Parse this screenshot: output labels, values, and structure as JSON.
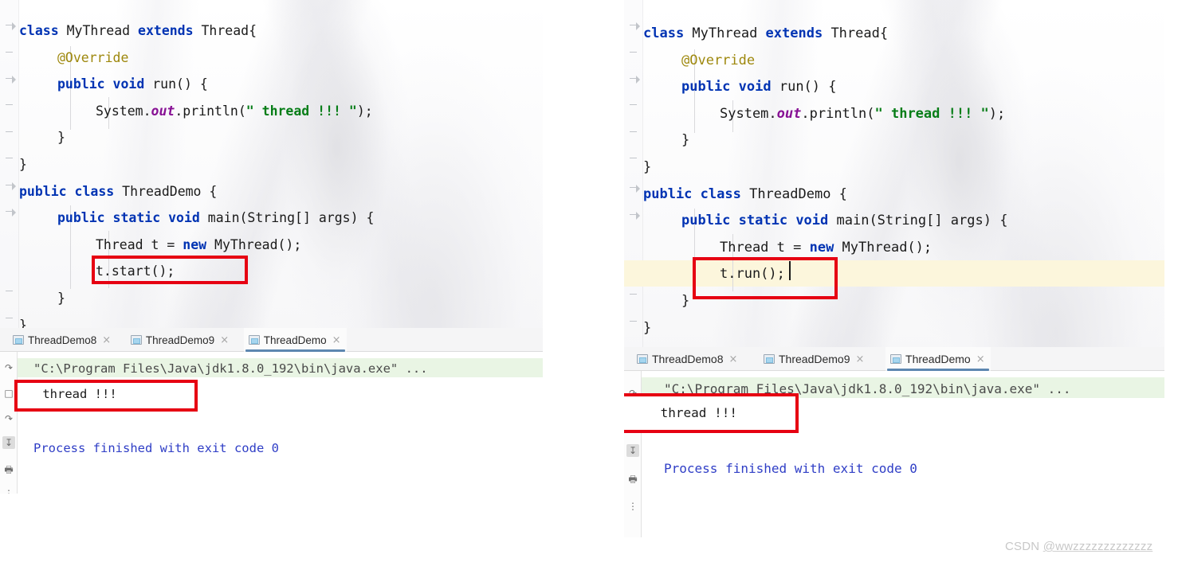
{
  "watermark": {
    "brand": "CSDN",
    "user": "@wwzzzzzzzzzzzzz"
  },
  "left_panel": {
    "name": "start-example-panel",
    "editor": {
      "lines": [
        {
          "indent": 0,
          "tokens": [
            {
              "t": "class ",
              "c": "kw"
            },
            {
              "t": "MyThread ",
              "c": "pln"
            },
            {
              "t": "extends ",
              "c": "kw"
            },
            {
              "t": "Thread{",
              "c": "pln"
            }
          ]
        },
        {
          "indent": 1,
          "tokens": [
            {
              "t": "@Override",
              "c": "ann"
            }
          ]
        },
        {
          "indent": 1,
          "tokens": [
            {
              "t": "public ",
              "c": "kw"
            },
            {
              "t": "void ",
              "c": "kw"
            },
            {
              "t": "run() {",
              "c": "pln"
            }
          ]
        },
        {
          "indent": 2,
          "tokens": [
            {
              "t": "System.",
              "c": "pln"
            },
            {
              "t": "out",
              "c": "fld"
            },
            {
              "t": ".println(",
              "c": "pln"
            },
            {
              "t": "\" thread !!! \"",
              "c": "str"
            },
            {
              "t": ");",
              "c": "pln"
            }
          ]
        },
        {
          "indent": 1,
          "tokens": [
            {
              "t": "}",
              "c": "pln"
            }
          ]
        },
        {
          "indent": 0,
          "tokens": [
            {
              "t": "}",
              "c": "pln"
            }
          ]
        },
        {
          "indent": 0,
          "tokens": [
            {
              "t": "public ",
              "c": "kw"
            },
            {
              "t": "class ",
              "c": "kw"
            },
            {
              "t": "ThreadDemo {",
              "c": "pln"
            }
          ]
        },
        {
          "indent": 1,
          "tokens": [
            {
              "t": "public ",
              "c": "kw"
            },
            {
              "t": "static ",
              "c": "kw"
            },
            {
              "t": "void ",
              "c": "kw"
            },
            {
              "t": "main(String[] args) {",
              "c": "pln"
            }
          ]
        },
        {
          "indent": 2,
          "tokens": [
            {
              "t": "Thread t = ",
              "c": "pln"
            },
            {
              "t": "new ",
              "c": "kw"
            },
            {
              "t": "MyThread();",
              "c": "pln"
            }
          ]
        },
        {
          "indent": 2,
          "tokens": [
            {
              "t": "t.start();",
              "c": "pln"
            }
          ]
        },
        {
          "indent": 1,
          "tokens": [
            {
              "t": "}",
              "c": "pln"
            }
          ]
        },
        {
          "indent": 0,
          "tokens": [
            {
              "t": "}",
              "c": "pln"
            }
          ]
        }
      ],
      "highlight_label": "t.start();"
    },
    "run_window": {
      "tabs": [
        {
          "label": "ThreadDemo8",
          "active": false,
          "close": "×"
        },
        {
          "label": "ThreadDemo9",
          "active": false,
          "close": "×"
        },
        {
          "label": "ThreadDemo",
          "active": true,
          "close": "×"
        }
      ],
      "console": {
        "command": "\"C:\\Program Files\\Java\\jdk1.8.0_192\\bin\\java.exe\" ...",
        "output": " thread !!!",
        "exit": "Process finished with exit code 0"
      }
    }
  },
  "right_panel": {
    "name": "run-example-panel",
    "editor": {
      "lines": [
        {
          "indent": 0,
          "tokens": [
            {
              "t": "class ",
              "c": "kw"
            },
            {
              "t": "MyThread ",
              "c": "pln"
            },
            {
              "t": "extends ",
              "c": "kw"
            },
            {
              "t": "Thread{",
              "c": "pln"
            }
          ]
        },
        {
          "indent": 1,
          "tokens": [
            {
              "t": "@Override",
              "c": "ann"
            }
          ]
        },
        {
          "indent": 1,
          "tokens": [
            {
              "t": "public ",
              "c": "kw"
            },
            {
              "t": "void ",
              "c": "kw"
            },
            {
              "t": "run() {",
              "c": "pln"
            }
          ]
        },
        {
          "indent": 2,
          "tokens": [
            {
              "t": "System.",
              "c": "pln"
            },
            {
              "t": "out",
              "c": "fld"
            },
            {
              "t": ".println(",
              "c": "pln"
            },
            {
              "t": "\" thread !!! \"",
              "c": "str"
            },
            {
              "t": ");",
              "c": "pln"
            }
          ]
        },
        {
          "indent": 1,
          "tokens": [
            {
              "t": "}",
              "c": "pln"
            }
          ]
        },
        {
          "indent": 0,
          "tokens": [
            {
              "t": "}",
              "c": "pln"
            }
          ]
        },
        {
          "indent": 0,
          "tokens": [
            {
              "t": "public ",
              "c": "kw"
            },
            {
              "t": "class ",
              "c": "kw"
            },
            {
              "t": "ThreadDemo {",
              "c": "pln"
            }
          ]
        },
        {
          "indent": 1,
          "tokens": [
            {
              "t": "public ",
              "c": "kw"
            },
            {
              "t": "static ",
              "c": "kw"
            },
            {
              "t": "void ",
              "c": "kw"
            },
            {
              "t": "main(String[] args) {",
              "c": "pln"
            }
          ]
        },
        {
          "indent": 2,
          "tokens": [
            {
              "t": "Thread t = ",
              "c": "pln"
            },
            {
              "t": "new ",
              "c": "kw"
            },
            {
              "t": "MyThread();",
              "c": "pln"
            }
          ]
        },
        {
          "indent": 2,
          "tokens": [
            {
              "t": "t.run();",
              "c": "pln"
            }
          ]
        },
        {
          "indent": 1,
          "tokens": [
            {
              "t": "}",
              "c": "pln"
            }
          ]
        },
        {
          "indent": 0,
          "tokens": [
            {
              "t": "}",
              "c": "pln"
            }
          ]
        }
      ],
      "highlight_label": "t.run();"
    },
    "run_window": {
      "tabs": [
        {
          "label": "ThreadDemo8",
          "active": false,
          "close": "×"
        },
        {
          "label": "ThreadDemo9",
          "active": false,
          "close": "×"
        },
        {
          "label": "ThreadDemo",
          "active": true,
          "close": "×"
        }
      ],
      "console": {
        "command": "\"C:\\Program Files\\Java\\jdk1.8.0_192\\bin\\java.exe\" ...",
        "output": " thread !!!",
        "exit": "Process finished with exit code 0"
      }
    }
  },
  "colors": {
    "keyword": "#0033b3",
    "string": "#067d17",
    "annotation": "#9e880d",
    "field": "#871094",
    "plain": "#1a1a1a",
    "process": "#2f3ec6",
    "annotation_box": "#e60012",
    "caret_line": "#fcf6dc",
    "command_highlight": "#e9f5e4",
    "tab_underline": "#5d87b0"
  }
}
